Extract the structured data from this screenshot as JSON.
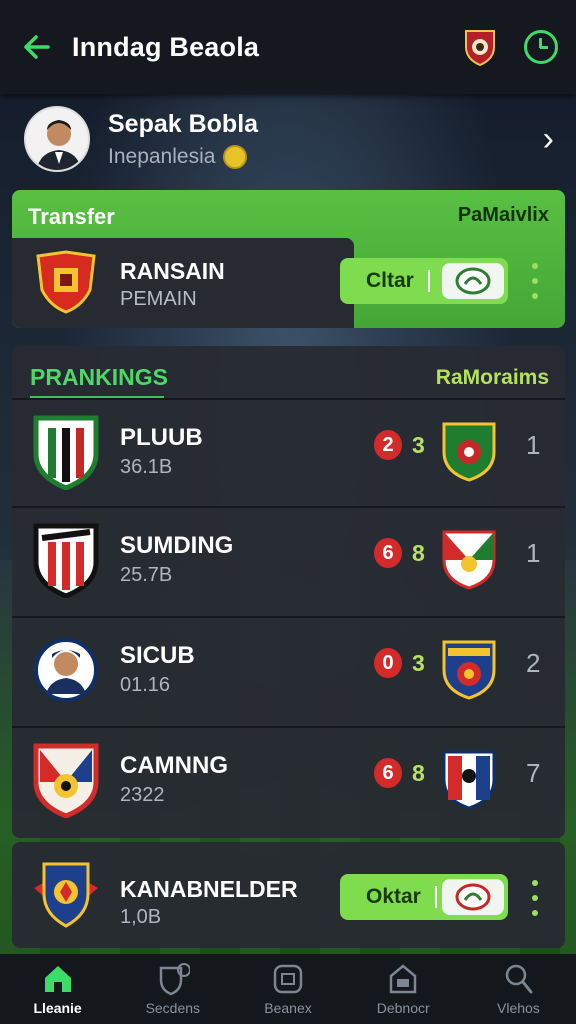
{
  "header": {
    "title": "Inndag Beaola"
  },
  "profile": {
    "name": "Sepak Bobla",
    "subtitle": "Inepanlesia"
  },
  "transfer": {
    "title": "Transfer",
    "right_label": "PaMaivlix",
    "club_name": "RANSAIN",
    "club_sub": "PEMAIN",
    "action_label": "Cltar"
  },
  "rankings": {
    "title": "PRANKINGS",
    "right_label": "RaMoraims",
    "rows": [
      {
        "name": "PLUUB",
        "sub": "36.1B",
        "score_a": "2",
        "score_b": "3",
        "rank": "1"
      },
      {
        "name": "SUMDING",
        "sub": "25.7B",
        "score_a": "6",
        "score_b": "8",
        "rank": "1"
      },
      {
        "name": "SICUB",
        "sub": "01.16",
        "score_a": "0",
        "score_b": "3",
        "rank": "2"
      },
      {
        "name": "CAMNNG",
        "sub": "2322",
        "score_a": "6",
        "score_b": "8",
        "rank": "7"
      }
    ]
  },
  "last_card": {
    "name": "KANABNELDER",
    "sub": "1,0B",
    "action_label": "Oktar"
  },
  "nav": [
    {
      "label": "Lleanie",
      "icon": "home-icon",
      "active": true
    },
    {
      "label": "Secdens",
      "icon": "shield-icon",
      "active": false
    },
    {
      "label": "Beanex",
      "icon": "tv-icon",
      "active": false
    },
    {
      "label": "Debnocr",
      "icon": "calendar-icon",
      "active": false
    },
    {
      "label": "Vlehos",
      "icon": "person-icon",
      "active": false
    }
  ],
  "colors": {
    "accent": "#3ddc6a",
    "card_green": "#4cb53a",
    "panel": "#282b32",
    "badge_red": "#d32a2a"
  }
}
